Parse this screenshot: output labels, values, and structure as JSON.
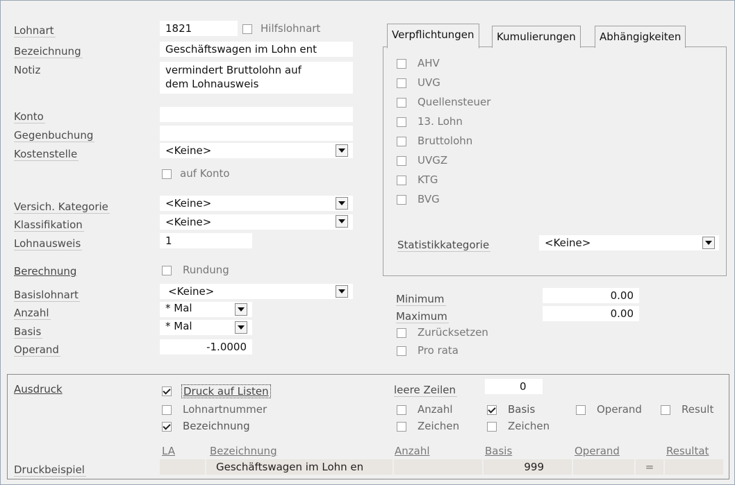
{
  "left": {
    "lohnart_label": "Lohnart",
    "lohnart_value": "1821",
    "hilfslohnart_label": "Hilfslohnart",
    "bezeichnung_label": "Bezeichnung",
    "bezeichnung_value": "Geschäftswagen im Lohn ent",
    "notiz_label": "Notiz",
    "notiz_line1": "vermindert Bruttolohn auf",
    "notiz_line2": "dem Lohnausweis",
    "konto_label": "Konto",
    "konto_value": "",
    "gegenbuchung_label": "Gegenbuchung",
    "gegenbuchung_value": "",
    "kostenstelle_label": "Kostenstelle",
    "kostenstelle_value": "<Keine>",
    "auf_konto_label": "auf Konto",
    "versich_label": "Versich. Kategorie",
    "versich_value": "<Keine>",
    "klassifikation_label": "Klassifikation",
    "klassifikation_value": "<Keine>",
    "lohnausweis_label": "Lohnausweis",
    "lohnausweis_value": "1",
    "berechnung_label": "Berechnung",
    "rundung_label": "Rundung",
    "basislohnart_label": "Basislohnart",
    "basislohnart_value": "<Keine>",
    "anzahl_label": "Anzahl",
    "anzahl_value": "* Mal",
    "basis_label": "Basis",
    "basis_value": "* Mal",
    "operand_label": "Operand",
    "operand_value": "-1.0000"
  },
  "tabs": [
    {
      "label": "Verpflichtungen",
      "active": true
    },
    {
      "label": "Kumulierungen",
      "active": false
    },
    {
      "label": "Abhängigkeiten",
      "active": false
    }
  ],
  "verpflichtungen": [
    "AHV",
    "UVG",
    "Quellensteuer",
    "13. Lohn",
    "Bruttolohn",
    "UVGZ",
    "KTG",
    "BVG"
  ],
  "statistik_label": "Statistikkategorie",
  "statistik_value": "<Keine>",
  "minmax": {
    "minimum_label": "Minimum",
    "minimum_value": "0.00",
    "maximum_label": "Maximum",
    "maximum_value": "0.00",
    "zuruecksetzen_label": "Zurücksetzen",
    "pro_rata_label": "Pro rata"
  },
  "ausdruck": {
    "ausdruck_label": "Ausdruck",
    "druck_auf_listen": "Druck auf Listen",
    "lohnartnummer": "Lohnartnummer",
    "bezeichnung": "Bezeichnung",
    "leere_zeilen_label": "leere Zeilen",
    "leere_zeilen_value": "0",
    "anzahl": "Anzahl",
    "basis": "Basis",
    "operand": "Operand",
    "result": "Result",
    "zeichen1": "Zeichen",
    "zeichen2": "Zeichen",
    "hdr_la": "LA",
    "hdr_bezeichnung": "Bezeichnung",
    "hdr_anzahl": "Anzahl",
    "hdr_basis": "Basis",
    "hdr_operand": "Operand",
    "hdr_resultat": "Resultat",
    "druckbeispiel_label": "Druckbeispiel",
    "beispiel_bezeichnung": "Geschäftswagen im Lohn en",
    "beispiel_basis": "999",
    "beispiel_equals": "="
  }
}
